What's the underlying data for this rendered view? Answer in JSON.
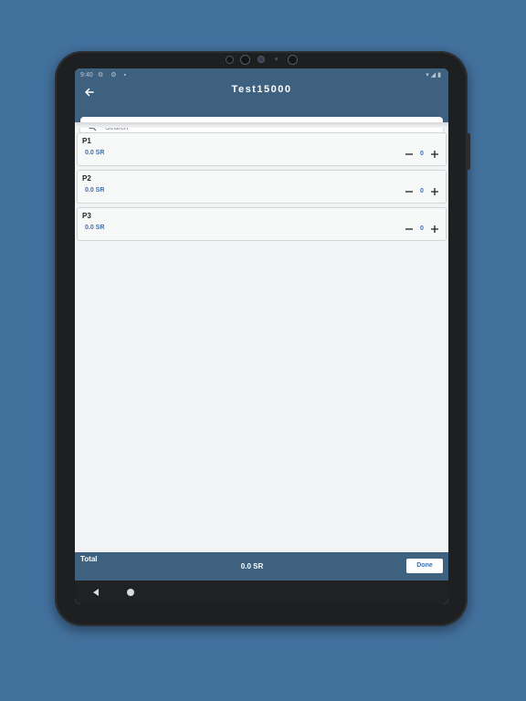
{
  "status_bar": {
    "time": "9:40"
  },
  "header": {
    "title": "Test15000"
  },
  "search": {
    "placeholder": "Search",
    "value": ""
  },
  "products": [
    {
      "name": "P1",
      "price": "0.0 SR",
      "quantity": "0"
    },
    {
      "name": "P2",
      "price": "0.0 SR",
      "quantity": "0"
    },
    {
      "name": "P3",
      "price": "0.0 SR",
      "quantity": "0"
    }
  ],
  "footer": {
    "total_label": "Total",
    "total_value": "0.0 SR",
    "done_label": "Done"
  },
  "colors": {
    "background": "#43719e",
    "app_bar": "#3e6180",
    "accent_text": "#3d6eb0",
    "screen": "#f2f3f4"
  },
  "icons": {
    "back": "arrow-left-icon",
    "search": "search-icon",
    "decrement": "minus-icon",
    "increment": "plus-icon",
    "nav_back": "triangle-back-icon",
    "nav_home": "circle-home-icon"
  }
}
